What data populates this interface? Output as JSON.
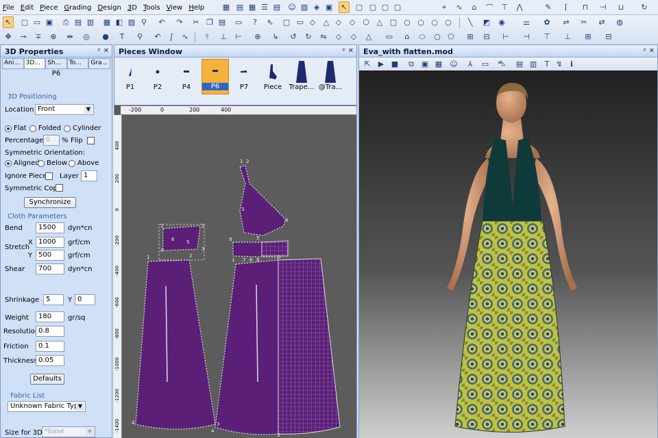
{
  "menu": [
    "File",
    "Edit",
    "Piece",
    "Grading",
    "Design",
    "3D",
    "Tools",
    "View",
    "Help"
  ],
  "props": {
    "title": "3D Properties",
    "tabs": [
      "Ani...",
      "3D...",
      "Sh...",
      "To...",
      "Gra..."
    ],
    "piece_name": "P6",
    "positioning_title": "3D Positioning",
    "location_label": "Location",
    "location_value": "Front",
    "flat": "Flat",
    "folded": "Folded",
    "cylinder": "Cylinder",
    "percentage_label": "Percentage",
    "percentage_value": "0",
    "percent_sign": "%",
    "flip_label": "Flip",
    "sym_orientation": "Symmetric Orientation:",
    "aligned": "Aligned",
    "below": "Below",
    "above": "Above",
    "ignore_piece": "Ignore Piece",
    "layer_label": "Layer",
    "layer_value": "1",
    "sym_copy": "Symmetric Copy",
    "synchronize": "Synchronize",
    "cloth_title": "Cloth Parameters",
    "bend_label": "Bend",
    "bend_value": "1500",
    "bend_unit": "dyn*cn",
    "stretch_label": "Stretch",
    "x_label": "X",
    "y_label": "Y",
    "stretch_x": "1000",
    "stretch_y": "500",
    "stretch_unit": "grf/cm",
    "shear_label": "Shear",
    "shear_value": "700",
    "shear_unit": "dyn*cn",
    "shrinkage_label": "Shrinkage",
    "shrink_x": "5",
    "shrink_y_label": "Y",
    "shrink_y": "0",
    "weight_label": "Weight",
    "weight_value": "180",
    "weight_unit": "gr/sq",
    "resolution_label": "Resolution",
    "resolution_value": "0.8",
    "friction_label": "Friction",
    "friction_value": "0.1",
    "thickness_label": "Thickness",
    "thickness_value": "0.05",
    "defaults": "Defaults",
    "fabric_list": "Fabric List",
    "fabric_value": "Unknown Fabric Type",
    "size_label": "Size for 3D",
    "size_value": "*base"
  },
  "pieces": {
    "title": "Pieces Window",
    "items": [
      "P1",
      "P2",
      "P4",
      "P6",
      "P7",
      "Piece",
      "Trape...",
      "@Tra..."
    ],
    "selected": 3,
    "ruler_x": [
      "-200",
      "0",
      "200",
      "400"
    ],
    "ruler_y": [
      "400",
      "200",
      "0",
      "-200",
      "-400",
      "-600",
      "-800",
      "-1000",
      "-1200",
      "-1400"
    ],
    "fabric_color": "#5b1f78"
  },
  "view3d": {
    "title": "Eva_with flatten.mod"
  },
  "panel_controls": {
    "pin": "ᵖ",
    "close": "✕"
  },
  "pt": [
    "1",
    "2",
    "3",
    "4",
    "5",
    "6",
    "7",
    "8",
    "9",
    "1",
    "2",
    "3",
    "4",
    "5",
    "6",
    "1",
    "2",
    "3",
    "4",
    "1",
    "2",
    "3",
    "4"
  ],
  "colors": {
    "accent": "#3163c6",
    "panel": "#cfe0f7",
    "viewport": "#2e2e2e"
  }
}
